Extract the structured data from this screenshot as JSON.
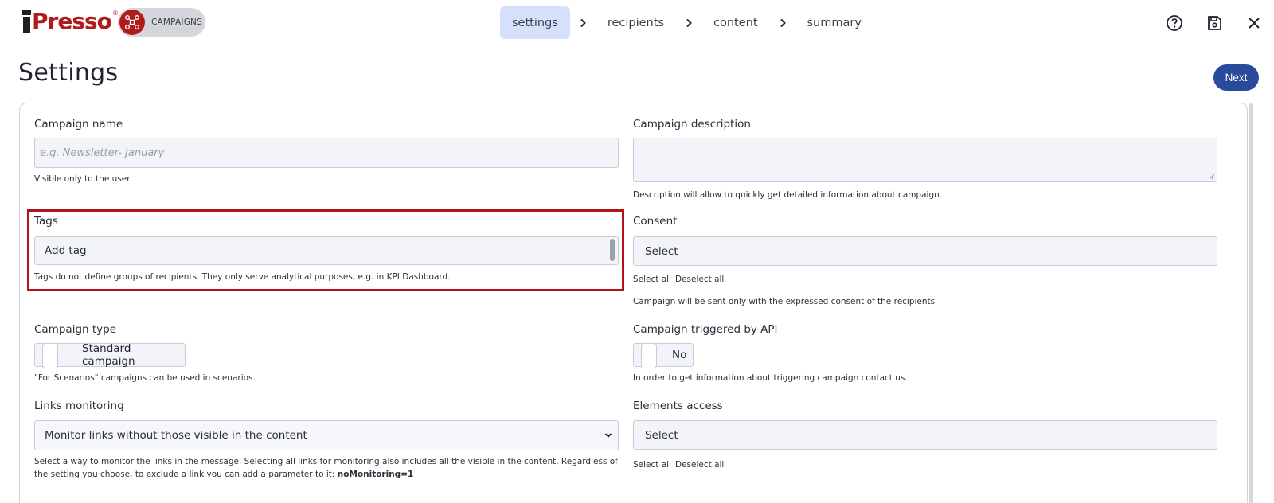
{
  "header": {
    "logo_text": "Presso",
    "logo_reg": "®",
    "module_label": "CAMPAIGNS",
    "steps": [
      {
        "label": "settings"
      },
      {
        "label": "recipients"
      },
      {
        "label": "content"
      },
      {
        "label": "summary"
      }
    ],
    "active_step": "settings",
    "icons": [
      "help-icon",
      "save-icon",
      "close-icon"
    ]
  },
  "page": {
    "title": "Settings",
    "next_label": "Next"
  },
  "form": {
    "campaign_name": {
      "label": "Campaign name",
      "placeholder": "e.g. Newsletter- January",
      "value": "",
      "help": "Visible only to the user."
    },
    "campaign_description": {
      "label": "Campaign description",
      "value": "",
      "help": "Description will allow to quickly get detailed information about campaign."
    },
    "tags": {
      "label": "Tags",
      "placeholder": "Add tag",
      "help": "Tags do not define groups of recipients. They only serve analytical purposes, e.g. in KPI Dashboard."
    },
    "consent": {
      "label": "Consent",
      "value": "Select",
      "select_all": "Select all",
      "deselect_all": "Deselect all",
      "help": "Campaign will be sent only with the expressed consent of the recipients"
    },
    "campaign_type": {
      "label": "Campaign type",
      "value": "Standard campaign",
      "help": "\"For Scenarios\" campaigns can be used in scenarios."
    },
    "triggered_by_api": {
      "label": "Campaign triggered by API",
      "value": "No",
      "help": "In order to get information about triggering campaign contact us."
    },
    "links_monitoring": {
      "label": "Links monitoring",
      "value": "Monitor links without those visible in the content",
      "help": "Select a way to monitor the links in the message. Selecting all links for monitoring also includes all the visible in the content. Regardless of the setting you choose, to exclude a link you can add a parameter to it:",
      "help_param": "noMonitoring=1"
    },
    "elements_access": {
      "label": "Elements access",
      "value": "Select",
      "select_all": "Select all",
      "deselect_all": "Deselect all"
    }
  },
  "colors": {
    "brand_red": "#b01c1c",
    "primary_blue": "#2a4a9b",
    "active_step_bg": "#d5e0fb",
    "highlight_border": "#b01217"
  }
}
